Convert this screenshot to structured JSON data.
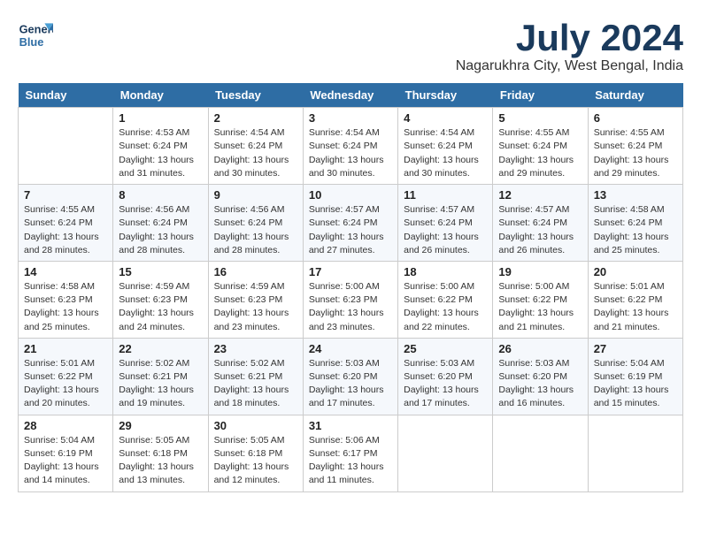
{
  "logo": {
    "line1": "General",
    "line2": "Blue"
  },
  "title": "July 2024",
  "subtitle": "Nagarukhra City, West Bengal, India",
  "weekdays": [
    "Sunday",
    "Monday",
    "Tuesday",
    "Wednesday",
    "Thursday",
    "Friday",
    "Saturday"
  ],
  "weeks": [
    [
      {
        "day": "",
        "sunrise": "",
        "sunset": "",
        "daylight": ""
      },
      {
        "day": "1",
        "sunrise": "Sunrise: 4:53 AM",
        "sunset": "Sunset: 6:24 PM",
        "daylight": "Daylight: 13 hours and 31 minutes."
      },
      {
        "day": "2",
        "sunrise": "Sunrise: 4:54 AM",
        "sunset": "Sunset: 6:24 PM",
        "daylight": "Daylight: 13 hours and 30 minutes."
      },
      {
        "day": "3",
        "sunrise": "Sunrise: 4:54 AM",
        "sunset": "Sunset: 6:24 PM",
        "daylight": "Daylight: 13 hours and 30 minutes."
      },
      {
        "day": "4",
        "sunrise": "Sunrise: 4:54 AM",
        "sunset": "Sunset: 6:24 PM",
        "daylight": "Daylight: 13 hours and 30 minutes."
      },
      {
        "day": "5",
        "sunrise": "Sunrise: 4:55 AM",
        "sunset": "Sunset: 6:24 PM",
        "daylight": "Daylight: 13 hours and 29 minutes."
      },
      {
        "day": "6",
        "sunrise": "Sunrise: 4:55 AM",
        "sunset": "Sunset: 6:24 PM",
        "daylight": "Daylight: 13 hours and 29 minutes."
      }
    ],
    [
      {
        "day": "7",
        "sunrise": "Sunrise: 4:55 AM",
        "sunset": "Sunset: 6:24 PM",
        "daylight": "Daylight: 13 hours and 28 minutes."
      },
      {
        "day": "8",
        "sunrise": "Sunrise: 4:56 AM",
        "sunset": "Sunset: 6:24 PM",
        "daylight": "Daylight: 13 hours and 28 minutes."
      },
      {
        "day": "9",
        "sunrise": "Sunrise: 4:56 AM",
        "sunset": "Sunset: 6:24 PM",
        "daylight": "Daylight: 13 hours and 28 minutes."
      },
      {
        "day": "10",
        "sunrise": "Sunrise: 4:57 AM",
        "sunset": "Sunset: 6:24 PM",
        "daylight": "Daylight: 13 hours and 27 minutes."
      },
      {
        "day": "11",
        "sunrise": "Sunrise: 4:57 AM",
        "sunset": "Sunset: 6:24 PM",
        "daylight": "Daylight: 13 hours and 26 minutes."
      },
      {
        "day": "12",
        "sunrise": "Sunrise: 4:57 AM",
        "sunset": "Sunset: 6:24 PM",
        "daylight": "Daylight: 13 hours and 26 minutes."
      },
      {
        "day": "13",
        "sunrise": "Sunrise: 4:58 AM",
        "sunset": "Sunset: 6:24 PM",
        "daylight": "Daylight: 13 hours and 25 minutes."
      }
    ],
    [
      {
        "day": "14",
        "sunrise": "Sunrise: 4:58 AM",
        "sunset": "Sunset: 6:23 PM",
        "daylight": "Daylight: 13 hours and 25 minutes."
      },
      {
        "day": "15",
        "sunrise": "Sunrise: 4:59 AM",
        "sunset": "Sunset: 6:23 PM",
        "daylight": "Daylight: 13 hours and 24 minutes."
      },
      {
        "day": "16",
        "sunrise": "Sunrise: 4:59 AM",
        "sunset": "Sunset: 6:23 PM",
        "daylight": "Daylight: 13 hours and 23 minutes."
      },
      {
        "day": "17",
        "sunrise": "Sunrise: 5:00 AM",
        "sunset": "Sunset: 6:23 PM",
        "daylight": "Daylight: 13 hours and 23 minutes."
      },
      {
        "day": "18",
        "sunrise": "Sunrise: 5:00 AM",
        "sunset": "Sunset: 6:22 PM",
        "daylight": "Daylight: 13 hours and 22 minutes."
      },
      {
        "day": "19",
        "sunrise": "Sunrise: 5:00 AM",
        "sunset": "Sunset: 6:22 PM",
        "daylight": "Daylight: 13 hours and 21 minutes."
      },
      {
        "day": "20",
        "sunrise": "Sunrise: 5:01 AM",
        "sunset": "Sunset: 6:22 PM",
        "daylight": "Daylight: 13 hours and 21 minutes."
      }
    ],
    [
      {
        "day": "21",
        "sunrise": "Sunrise: 5:01 AM",
        "sunset": "Sunset: 6:22 PM",
        "daylight": "Daylight: 13 hours and 20 minutes."
      },
      {
        "day": "22",
        "sunrise": "Sunrise: 5:02 AM",
        "sunset": "Sunset: 6:21 PM",
        "daylight": "Daylight: 13 hours and 19 minutes."
      },
      {
        "day": "23",
        "sunrise": "Sunrise: 5:02 AM",
        "sunset": "Sunset: 6:21 PM",
        "daylight": "Daylight: 13 hours and 18 minutes."
      },
      {
        "day": "24",
        "sunrise": "Sunrise: 5:03 AM",
        "sunset": "Sunset: 6:20 PM",
        "daylight": "Daylight: 13 hours and 17 minutes."
      },
      {
        "day": "25",
        "sunrise": "Sunrise: 5:03 AM",
        "sunset": "Sunset: 6:20 PM",
        "daylight": "Daylight: 13 hours and 17 minutes."
      },
      {
        "day": "26",
        "sunrise": "Sunrise: 5:03 AM",
        "sunset": "Sunset: 6:20 PM",
        "daylight": "Daylight: 13 hours and 16 minutes."
      },
      {
        "day": "27",
        "sunrise": "Sunrise: 5:04 AM",
        "sunset": "Sunset: 6:19 PM",
        "daylight": "Daylight: 13 hours and 15 minutes."
      }
    ],
    [
      {
        "day": "28",
        "sunrise": "Sunrise: 5:04 AM",
        "sunset": "Sunset: 6:19 PM",
        "daylight": "Daylight: 13 hours and 14 minutes."
      },
      {
        "day": "29",
        "sunrise": "Sunrise: 5:05 AM",
        "sunset": "Sunset: 6:18 PM",
        "daylight": "Daylight: 13 hours and 13 minutes."
      },
      {
        "day": "30",
        "sunrise": "Sunrise: 5:05 AM",
        "sunset": "Sunset: 6:18 PM",
        "daylight": "Daylight: 13 hours and 12 minutes."
      },
      {
        "day": "31",
        "sunrise": "Sunrise: 5:06 AM",
        "sunset": "Sunset: 6:17 PM",
        "daylight": "Daylight: 13 hours and 11 minutes."
      },
      {
        "day": "",
        "sunrise": "",
        "sunset": "",
        "daylight": ""
      },
      {
        "day": "",
        "sunrise": "",
        "sunset": "",
        "daylight": ""
      },
      {
        "day": "",
        "sunrise": "",
        "sunset": "",
        "daylight": ""
      }
    ]
  ]
}
